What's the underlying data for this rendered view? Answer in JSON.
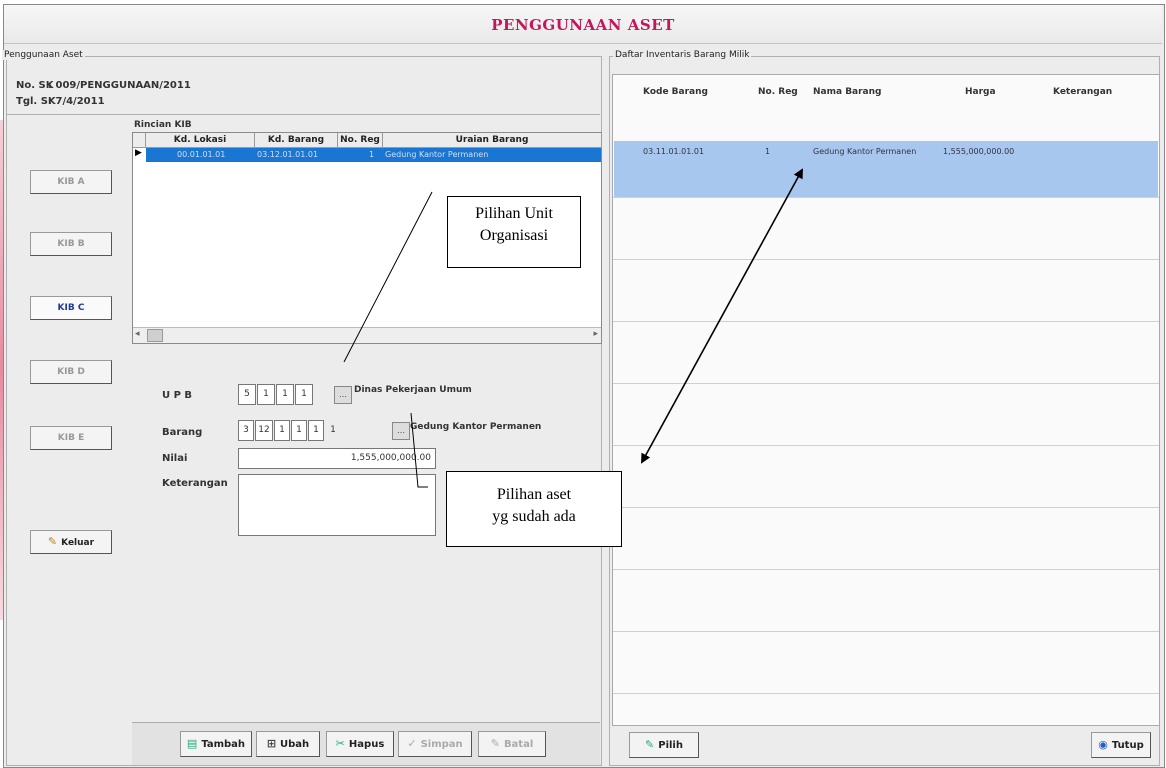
{
  "window": {
    "title": "PENGGUNAAN ASET"
  },
  "left_panel": {
    "group_title": "Penggunaan Aset",
    "no_sk_label": "No. SK",
    "no_sk_value": ": 009/PENGGUNAAN/2011",
    "tgl_sk_label": "Tgl. SK",
    "tgl_sk_value": ": 7/4/2011"
  },
  "kib_buttons": [
    "KIB A",
    "KIB B",
    "KIB C",
    "KIB D",
    "KIB E"
  ],
  "keluar_label": "Keluar",
  "rincian": {
    "title": "Rincian KIB",
    "columns": [
      "Kd. Lokasi",
      "Kd. Barang",
      "No. Reg",
      "Uraian Barang"
    ],
    "rows": [
      [
        "00.01.01.01",
        "03.12.01.01.01",
        "1",
        "Gedung Kantor Permanen"
      ]
    ]
  },
  "form": {
    "upb_label": "U P B",
    "upb_values": [
      "5",
      "1",
      "1",
      "1"
    ],
    "upb_desc": "Dinas Pekerjaan Umum",
    "barang_label": "Barang",
    "barang_values": [
      "3",
      "12",
      "1",
      "1",
      "1",
      "1"
    ],
    "barang_desc": "Gedung Kantor Permanen",
    "nilai_label": "Nilai",
    "nilai_value": "1,555,000,000.00",
    "keterangan_label": "Keterangan",
    "keterangan_value": ""
  },
  "toolbar": {
    "tambah": "Tambah",
    "ubah": "Ubah",
    "hapus": "Hapus",
    "simpan": "Simpan",
    "batal": "Batal"
  },
  "right_panel": {
    "title": "Daftar Inventaris Barang Milik",
    "columns": [
      "Kode Barang",
      "No. Reg",
      "Nama Barang",
      "Harga",
      "Keterangan"
    ],
    "rows": [
      [
        "03.11.01.01.01",
        "1",
        "Gedung Kantor Permanen",
        "1,555,000,000.00",
        ""
      ]
    ],
    "pilih": "Pilih",
    "tutup": "Tutup"
  },
  "callouts": {
    "unit_org": [
      "Pilihan Unit",
      "Organisasi"
    ],
    "aset": [
      "Pilihan aset",
      "yg sudah ada"
    ]
  },
  "colors": {
    "title": "#c2185b",
    "selection": "#1976d2",
    "right_selection": "#a8c7ef"
  }
}
